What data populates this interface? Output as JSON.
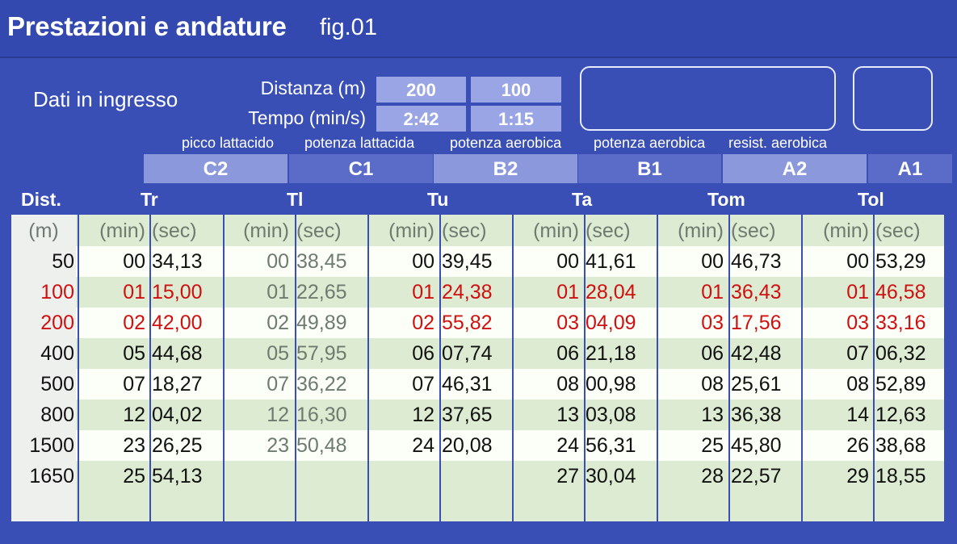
{
  "header": {
    "title": "Prestazioni e andature",
    "fig": "fig.01"
  },
  "input": {
    "label": "Dati in ingresso",
    "distance_label": "Distanza (m)",
    "time_label": "Tempo (min/s)",
    "distances": [
      "200",
      "100"
    ],
    "times": [
      "2:42",
      "1:15"
    ]
  },
  "categories": [
    {
      "code": "C2",
      "desc": "picco lattacido"
    },
    {
      "code": "C1",
      "desc": "potenza lattacida"
    },
    {
      "code": "B2",
      "desc": "potenza aerobica"
    },
    {
      "code": "B1",
      "desc": "potenza aerobica"
    },
    {
      "code": "A2",
      "desc": "resist. aerobica"
    },
    {
      "code": "A1",
      "desc": ""
    }
  ],
  "table": {
    "dist_header": "Dist.",
    "dist_unit": "(m)",
    "min_unit": "(min)",
    "sec_unit": "(sec)",
    "columns": [
      "Tr",
      "Tl",
      "Tu",
      "Ta",
      "Tom",
      "Tol"
    ],
    "rows": [
      {
        "dist": "50",
        "values": [
          [
            "00",
            "34,13"
          ],
          [
            "00",
            "38,45"
          ],
          [
            "00",
            "39,45"
          ],
          [
            "00",
            "41,61"
          ],
          [
            "00",
            "46,73"
          ],
          [
            "00",
            "53,29"
          ]
        ]
      },
      {
        "dist": "100",
        "values": [
          [
            "01",
            "15,00"
          ],
          [
            "01",
            "22,65"
          ],
          [
            "01",
            "24,38"
          ],
          [
            "01",
            "28,04"
          ],
          [
            "01",
            "36,43"
          ],
          [
            "01",
            "46,58"
          ]
        ]
      },
      {
        "dist": "200",
        "values": [
          [
            "02",
            "42,00"
          ],
          [
            "02",
            "49,89"
          ],
          [
            "02",
            "55,82"
          ],
          [
            "03",
            "04,09"
          ],
          [
            "03",
            "17,56"
          ],
          [
            "03",
            "33,16"
          ]
        ]
      },
      {
        "dist": "400",
        "values": [
          [
            "05",
            "44,68"
          ],
          [
            "05",
            "57,95"
          ],
          [
            "06",
            "07,74"
          ],
          [
            "06",
            "21,18"
          ],
          [
            "06",
            "42,48"
          ],
          [
            "07",
            "06,32"
          ]
        ]
      },
      {
        "dist": "500",
        "values": [
          [
            "07",
            "18,27"
          ],
          [
            "07",
            "36,22"
          ],
          [
            "07",
            "46,31"
          ],
          [
            "08",
            "00,98"
          ],
          [
            "08",
            "25,61"
          ],
          [
            "08",
            "52,89"
          ]
        ]
      },
      {
        "dist": "800",
        "values": [
          [
            "12",
            "04,02"
          ],
          [
            "12",
            "16,30"
          ],
          [
            "12",
            "37,65"
          ],
          [
            "13",
            "03,08"
          ],
          [
            "13",
            "36,38"
          ],
          [
            "14",
            "12,63"
          ]
        ]
      },
      {
        "dist": "1500",
        "values": [
          [
            "23",
            "26,25"
          ],
          [
            "23",
            "50,48"
          ],
          [
            "24",
            "20,08"
          ],
          [
            "24",
            "56,31"
          ],
          [
            "25",
            "45,80"
          ],
          [
            "26",
            "38,68"
          ]
        ]
      },
      {
        "dist": "1650",
        "values": [
          [
            "25",
            "54,13"
          ],
          [
            "",
            ""
          ],
          [
            "",
            ""
          ],
          [
            "27",
            "30,04"
          ],
          [
            "28",
            "22,57"
          ],
          [
            "29",
            "18,55"
          ]
        ]
      }
    ]
  },
  "colors": {
    "background": "#3a4fb5",
    "highlight_text": "#d01010",
    "muted_text": "#6f7a70",
    "normal_text": "#111111"
  }
}
